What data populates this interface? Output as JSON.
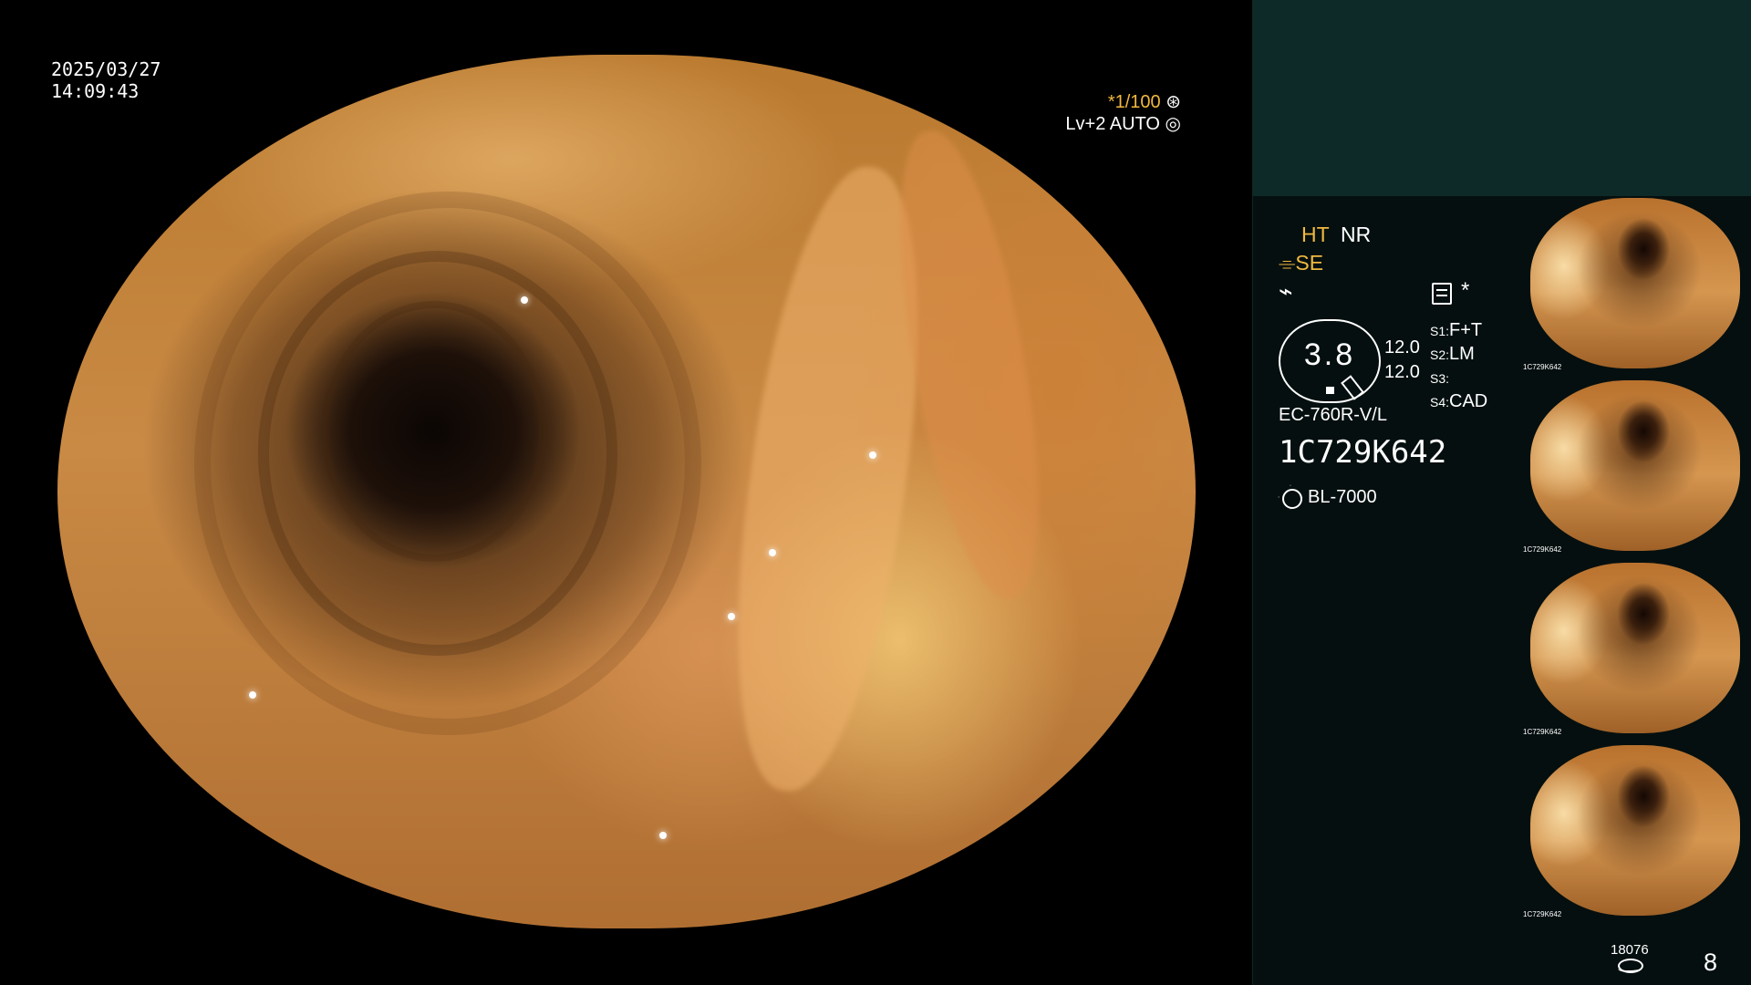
{
  "main_view": {
    "date": "2025/03/27",
    "time": "14:09:43",
    "shutter_speed": "*1/100",
    "shutter_icon": "aperture-icon",
    "enhancement": "Lv+2 AUTO",
    "enhancement_icon": "iris-icon"
  },
  "panel": {
    "ht_label": "HT",
    "nr_label": "NR",
    "se_label": "SE",
    "wave_symbol": "⌁",
    "asterisk": "*",
    "gauge_value": "3.8",
    "stat_1": "12.0",
    "stat_2": "12.0",
    "slots": [
      {
        "id": "S1:",
        "value": "F+T"
      },
      {
        "id": "S2:",
        "value": "LM"
      },
      {
        "id": "S3:",
        "value": ""
      },
      {
        "id": "S4:",
        "value": "CAD"
      }
    ],
    "scope_model": "EC-760R-V/L",
    "scope_serial": "1C729K642",
    "light_source": "BL-7000"
  },
  "thumbnails": [
    {
      "serial": "1C729K642"
    },
    {
      "serial": "1C729K642"
    },
    {
      "serial": "1C729K642"
    },
    {
      "serial": "1C729K642"
    }
  ],
  "footer": {
    "counter": "18076",
    "page_number": "8"
  }
}
